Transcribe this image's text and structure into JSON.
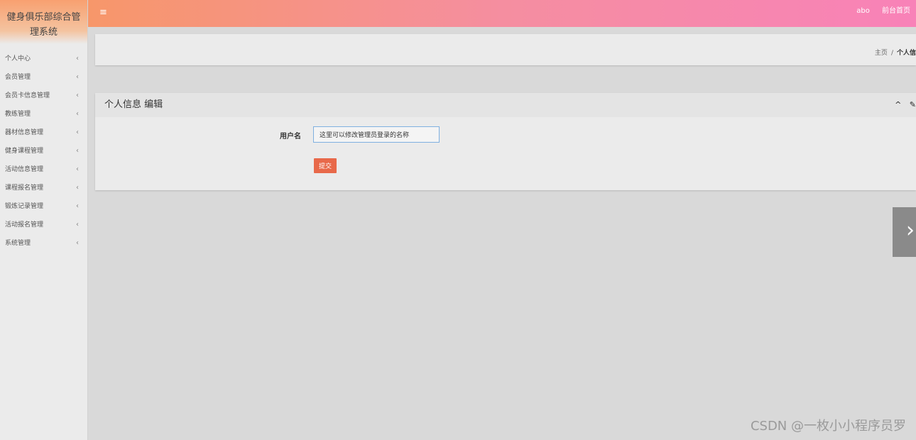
{
  "app": {
    "title": "健身俱乐部综合管理系统"
  },
  "sidebar": {
    "items": [
      {
        "label": "个人中心"
      },
      {
        "label": "会员管理"
      },
      {
        "label": "会员卡信息管理"
      },
      {
        "label": "教练管理"
      },
      {
        "label": "器材信息管理"
      },
      {
        "label": "健身课程管理"
      },
      {
        "label": "活动信息管理"
      },
      {
        "label": "课程报名管理"
      },
      {
        "label": "锻炼记录管理"
      },
      {
        "label": "活动报名管理"
      },
      {
        "label": "系统管理"
      }
    ],
    "chevron": "‹"
  },
  "topbar": {
    "menu_icon": "≡",
    "user": "abo",
    "home_link": "前台首页"
  },
  "breadcrumb": {
    "home": "主页",
    "separator": "/",
    "current": "个人信"
  },
  "panel": {
    "title": "个人信息 编辑",
    "collapse_icon": "^",
    "settings_icon": "✎"
  },
  "form": {
    "username_label": "用户名",
    "username_value": "这里可以修改管理员登录的名称",
    "submit_label": "提交"
  },
  "next_arrow": "›",
  "watermark": "CSDN @一枚小小程序员罗",
  "colors": {
    "topbar_start": "#f7976a",
    "topbar_end": "#f882b8",
    "submit": "#e8694a"
  }
}
